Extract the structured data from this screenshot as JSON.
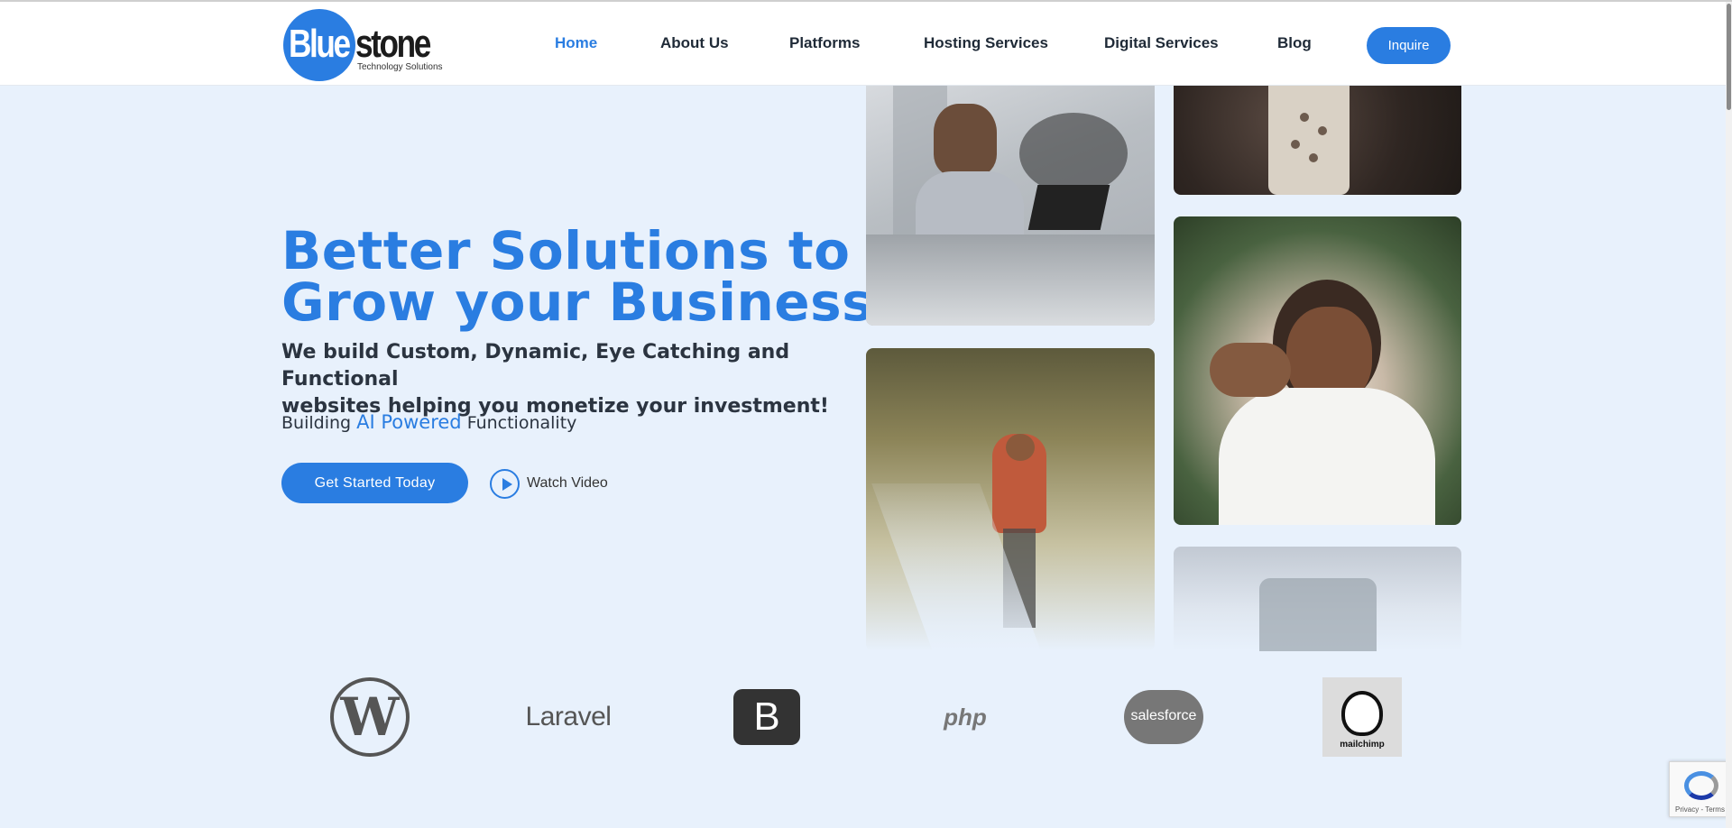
{
  "header": {
    "logo_blue": "Blue",
    "logo_stone": "stone",
    "logo_tagline": "Technology Solutions",
    "nav": [
      {
        "label": "Home",
        "active": true
      },
      {
        "label": "About Us",
        "active": false
      },
      {
        "label": "Platforms",
        "active": false
      },
      {
        "label": "Hosting Services",
        "active": false
      },
      {
        "label": "Digital Services",
        "active": false
      },
      {
        "label": "Blog",
        "active": false
      }
    ],
    "inquire_label": "Inquire"
  },
  "hero": {
    "title_line1": "Better Solutions to",
    "title_line2": "Grow your Business",
    "subtitle_line1": "We build Custom, Dynamic, Eye Catching and Functional",
    "subtitle_line2": "websites helping you monetize your investment!",
    "ai_prefix": "Building",
    "ai_highlight": "AI Powered",
    "ai_suffix": "Functionality",
    "cta_label": "Get Started Today",
    "watch_label": "Watch Video"
  },
  "photos": [
    {
      "name": "woman-at-laptop-photo"
    },
    {
      "name": "smartwatch-photo"
    },
    {
      "name": "woman-walking-photo"
    },
    {
      "name": "smiling-woman-photo"
    },
    {
      "name": "phone-photo"
    }
  ],
  "tech_logos": {
    "wordpress": "W",
    "laravel": "Laravel",
    "bootstrap": "B",
    "php": "php",
    "salesforce": "salesforce",
    "mailchimp": "mailchimp"
  },
  "recaptcha": {
    "footer": "Privacy - Terms"
  },
  "colors": {
    "accent": "#2a7de1",
    "page_bg": "#e8f1fc",
    "text_dark": "#1f2a37"
  }
}
